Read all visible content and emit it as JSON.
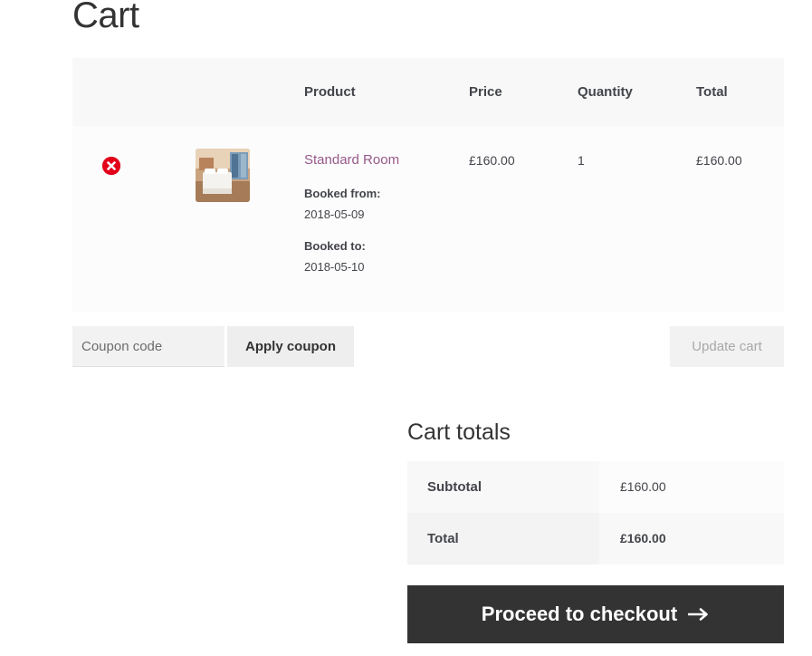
{
  "page": {
    "title": "Cart"
  },
  "cart": {
    "headers": {
      "product": "Product",
      "price": "Price",
      "quantity": "Quantity",
      "total": "Total"
    },
    "items": [
      {
        "name": "Standard Room",
        "booked_from_label": "Booked from:",
        "booked_from": "2018-05-09",
        "booked_to_label": "Booked to:",
        "booked_to": "2018-05-10",
        "price": "£160.00",
        "quantity": "1",
        "total": "£160.00",
        "remove_icon": "remove-icon",
        "thumbnail_icon": "hotel-room-thumbnail"
      }
    ]
  },
  "coupon": {
    "placeholder": "Coupon code",
    "apply_label": "Apply coupon"
  },
  "update_cart_label": "Update cart",
  "totals": {
    "title": "Cart totals",
    "subtotal_label": "Subtotal",
    "subtotal_value": "£160.00",
    "total_label": "Total",
    "total_value": "£160.00"
  },
  "checkout": {
    "label": "Proceed to checkout",
    "icon": "arrow-right-icon"
  },
  "colors": {
    "remove": "#e2001a",
    "product_link": "#96588a",
    "checkout_bg": "#333333"
  }
}
